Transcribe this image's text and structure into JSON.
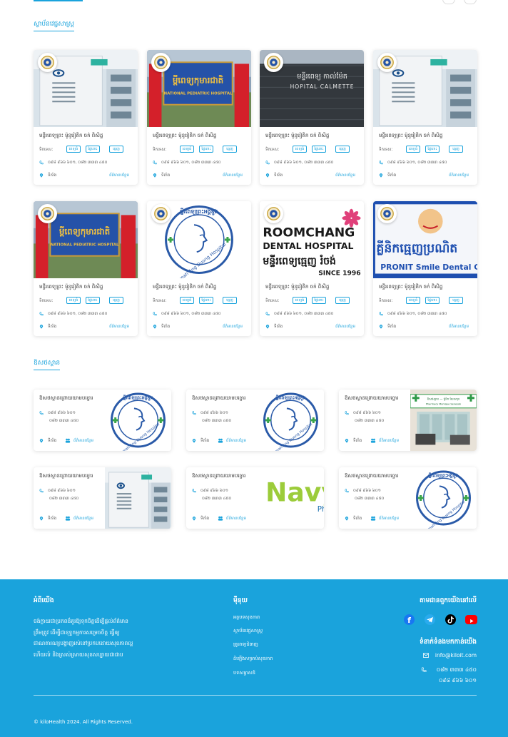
{
  "hospitals_section": {
    "title": "ស្ថាប័នវេជ្ជសាស្ត្រ",
    "cards": [
      {
        "name": "មន្ទីរពេទ្យព្រះ ម៉ូនូរៀតិក ចក់ ពិសិដ្ឋ",
        "services_label": "ទិកទេសៈ",
        "tags": [
          "ពេទ្យធំ",
          "ផ្ទៃពោះ",
          "ធ្មេញ"
        ],
        "phone": "០៩៨ ៩៦៦ ៦០១, ០៨២ ៣៣៣ ៤៥០",
        "location": "ទីតាំង",
        "more": "ព័ត៌មានបន្ថែម",
        "image": "eye-hospital-building"
      },
      {
        "name": "មន្ទីរពេទ្យព្រះ ម៉ូនូរៀតិក ចក់ ពិសិដ្ឋ",
        "services_label": "ទិកទេសៈ",
        "tags": [
          "ពេទ្យធំ",
          "ផ្ទៃពោះ",
          "ធ្មេញ"
        ],
        "phone": "០៩៨ ៩៦៦ ៦០១, ០៨២ ៣៣៣ ៤៥០",
        "location": "ទីតាំង",
        "more": "ព័ត៌មានបន្ថែម",
        "image": "national-pediatric-hospital-sign"
      },
      {
        "name": "មន្ទីរពេទ្យព្រះ ម៉ូនូរៀតិក ចក់ ពិសិដ្ឋ",
        "services_label": "ទិកទេសៈ",
        "tags": [
          "ពេទ្យធំ",
          "ផ្ទៃពោះ",
          "ធ្មេញ"
        ],
        "phone": "០៩៨ ៩៦៦ ៦០១, ០៨២ ៣៣៣ ៤៥០",
        "location": "ទីតាំង",
        "more": "ព័ត៌មានបន្ថែម",
        "image": "hospital-calmette-sign"
      },
      {
        "name": "មន្ទីរពេទ្យព្រះ ម៉ូនូរៀតិក ចក់ ពិសិដ្ឋ",
        "services_label": "ទិកទេសៈ",
        "tags": [
          "ពេទ្យធំ",
          "ផ្ទៃពោះ",
          "ធ្មេញ"
        ],
        "phone": "០៩៨ ៩៦៦ ៦០១, ០៨២ ៣៣៣ ៤៥០",
        "location": "ទីតាំង",
        "more": "ព័ត៌មានបន្ថែម",
        "image": "eye-hospital-building"
      },
      {
        "name": "មន្ទីរពេទ្យព្រះ ម៉ូនូរៀតិក ចក់ ពិសិដ្ឋ",
        "services_label": "ទិកទេសៈ",
        "tags": [
          "ពេទ្យធំ",
          "ផ្ទៃពោះ",
          "ធ្មេញ"
        ],
        "phone": "០៩៨ ៩៦៦ ៦០១, ០៨២ ៣៣៣ ៤៥០",
        "location": "ទីតាំង",
        "more": "ព័ត៌មានបន្ថែម",
        "image": "national-pediatric-hospital-sign"
      },
      {
        "name": "មន្ទីរពេទ្យព្រះ ម៉ូនូរៀតិក ចក់ ពិសិដ្ឋ",
        "services_label": "ទិកទេសៈ",
        "tags": [
          "ពេទ្យធំ",
          "ផ្ទៃពោះ",
          "ធ្មេញ"
        ],
        "phone": "០៩៨ ៩៦៦ ៦០១, ០៨២ ៣៣៣ ៤៥០",
        "location": "ទីតាំង",
        "more": "ព័ត៌មានបន្ថែម",
        "image": "preah-ang-duong-logo"
      },
      {
        "name": "មន្ទីរពេទ្យព្រះ ម៉ូនូរៀតិក ចក់ ពិសិដ្ឋ",
        "services_label": "ទិកទេសៈ",
        "tags": [
          "ពេទ្យធំ",
          "ផ្ទៃពោះ",
          "ធ្មេញ"
        ],
        "phone": "០៩៨ ៩៦៦ ៦០១, ០៨២ ៣៣៣ ៤៥០",
        "location": "ទីតាំង",
        "more": "ព័ត៌មានបន្ថែម",
        "image": "roomchang-dental-logo"
      },
      {
        "name": "មន្ទីរពេទ្យព្រះ ម៉ូនូរៀតិក ចក់ ពិសិដ្ឋ",
        "services_label": "ទិកទេសៈ",
        "tags": [
          "ពេទ្យធំ",
          "ផ្ទៃពោះ",
          "ធ្មេញ"
        ],
        "phone": "០៩៨ ៩៦៦ ៦០១, ០៨២ ៣៣៣ ៤៥០",
        "location": "ទីតាំង",
        "more": "ព័ត៌មានបន្ថែម",
        "image": "pronit-smile-dental-sign"
      }
    ],
    "logo_texts": {
      "pediatric_kh": "ម្ពីពេទ្យកុមារជាតិ",
      "pediatric_en": "NATIONAL PEDIATRIC HOSPITAL",
      "calmette_kh": "មន្ទីរពេទ្យ កាល់ម៉ែត",
      "calmette_en": "HOPITAL CALMETTE",
      "ang_duong": "Preah Ang Duong Hospital",
      "roomchang_1": "ROOMCHANG",
      "roomchang_2": "DENTAL HOSPITAL",
      "roomchang_kh": "មន្ទីរពេទ្យធ្មេញ រំចង់",
      "roomchang_since": "SINCE 1996",
      "pronit_kh": "គ្លីនិកធ្មេញប្រណិត",
      "pronit_en": "PRONIT Smile Dental Cli"
    }
  },
  "pharmacies_section": {
    "title": "ឱសថស្ថាន",
    "cards": [
      {
        "name": "ឱសថស្ថានព្រោយយាមបច្ចោរ",
        "phone1": "០៩៨ ៩៦៦ ៦០១",
        "phone2": "០៨២ ៣៣៣ ៤៥០",
        "location": "ទីតាំង",
        "more": "ព័ត៌មានបន្ថែម",
        "image": "preah-ang-duong-logo"
      },
      {
        "name": "ឱសថស្ថានព្រោយយាមបច្ចោរ",
        "phone1": "០៩៨ ៩៦៦ ៦០១",
        "phone2": "០៨២ ៣៣៣ ៤៥០",
        "location": "ទីតាំង",
        "more": "ព័ត៌មានបន្ថែម",
        "image": "preah-ang-duong-logo"
      },
      {
        "name": "ឱសថស្ថានព្រោយយាមបច្ចោរ",
        "phone1": "០៩៨ ៩៦៦ ៦០១",
        "phone2": "០៨២ ៣៣៣ ៤៥០",
        "location": "ទីតាំង",
        "more": "ព័ត៌មានបន្ថែម",
        "image": "pharmacy-storefront"
      },
      {
        "name": "ឱសថស្ថានព្រោយយាមបច្ចោរ",
        "phone1": "០៩៨ ៩៦៦ ៦០១",
        "phone2": "០៨២ ៣៣៣ ៤៥០",
        "location": "ទីតាំង",
        "more": "ព័ត៌មានបន្ថែម",
        "image": "eye-hospital-building"
      },
      {
        "name": "ឱសថស្ថានព្រោយយាមបច្ចោរ",
        "phone1": "០៩៨ ៩៦៦ ៦០១",
        "phone2": "០៨២ ៣៣៣ ៤៥០",
        "location": "ទីតាំង",
        "more": "ព័ត៌មានបន្ថែម",
        "image": "navy-logo"
      },
      {
        "name": "ឱសថស្ថានព្រោយយាមបច្ចោរ",
        "phone1": "០៩៨ ៩៦៦ ៦០១",
        "phone2": "០៨២ ៣៣៣ ៤៥០",
        "location": "ទីតាំង",
        "more": "ព័ត៌មានបន្ថែម",
        "image": "preah-ang-duong-logo"
      }
    ],
    "pharmacy_sign_kh": "ឱសថស្ថាន — ម៉ូនិក សែនសុខ",
    "pharmacy_sign_en": "Pharmacy Monique Senesok",
    "navy_text": "Navy"
  },
  "footer": {
    "about_title": "អំពីយើង",
    "about_text": "ចង់ក្លាយជាប្រភពដ៏គួរឱ្យទុកចិត្តដើម្បីផ្តល់ព័ត៌មានត្រឹមត្រូវ ដើម្បីជាខុទ្ទកម្មការសម្រេចចិត្ត ធ្វើឲ្យជាណតារណ្យបង្ហាញរស់នៅប្រកបដោយសុខភាពល្អហើយលំ និងស្រស់ស្រាយសុខសប្បាយជាជាប",
    "menu_title": "ម៉ឺនុយ",
    "menu_items": [
      "អត្ថបទសុខភាព",
      "ស្ថាប័នវេជ្ជសាស្ត្រ",
      "គ្រូពេទ្យជំនាញ",
      "ដំឡើងសម្រាប់សុខភាព",
      "បទសម្ភាសន៍"
    ],
    "follow_title": "តាមដានពួកយើងនៅលើ",
    "social": [
      {
        "icon": "facebook-icon",
        "color": "#1877f2"
      },
      {
        "icon": "telegram-icon",
        "color": "#2aabee"
      },
      {
        "icon": "tiktok-icon",
        "color": "#000000"
      },
      {
        "icon": "youtube-icon",
        "color": "#ff0000"
      }
    ],
    "contact_title": "ទំនាក់ទំនងមកកាន់យើង",
    "email": "info@kiloit.com",
    "phone1": "០៨២ ៣៣៣ ៤៥០",
    "phone2": "០៩៨ ៩៦៦ ៦០១",
    "copyright": "© kiloHealth  2024. All Rights Reserved."
  },
  "colors": {
    "accent": "#1aa3dc",
    "footer_bg": "#1aa3dc"
  }
}
